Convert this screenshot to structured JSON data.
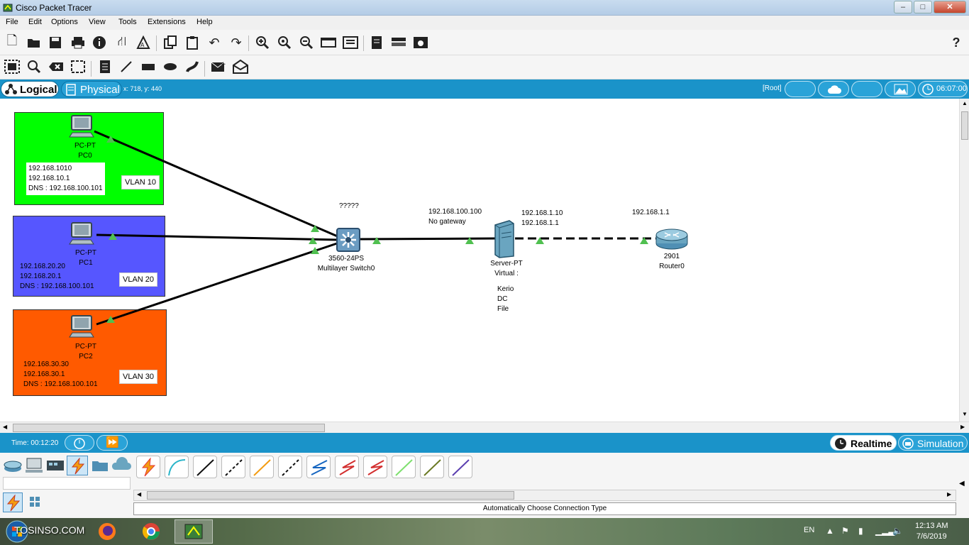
{
  "window": {
    "title": "Cisco Packet Tracer",
    "controls": [
      "–",
      "□",
      "✕"
    ]
  },
  "menu": [
    "File",
    "Edit",
    "Options",
    "View",
    "Tools",
    "Extensions",
    "Help"
  ],
  "help_glyph": "?",
  "workspace_bar": {
    "logical_label": "Logical",
    "physical_label": "Physical",
    "coords": "x: 718, y: 440",
    "root_label": "[Root]",
    "clock": "06:07:00"
  },
  "vlans": [
    {
      "label": "VLAN 10",
      "color": "#00ff00",
      "device_type": "PC-PT",
      "device_name": "PC0",
      "lines": [
        "192.168.1010",
        "192.168.10.1",
        "DNS : 192.168.100.101"
      ]
    },
    {
      "label": "VLAN 20",
      "color": "#5656ff",
      "device_type": "PC-PT",
      "device_name": "PC1",
      "lines": [
        "192.168.20.20",
        "192.168.20.1",
        "DNS : 192.168.100.101"
      ]
    },
    {
      "label": "VLAN 30",
      "color": "#ff5a00",
      "device_type": "PC-PT",
      "device_name": "PC2",
      "lines": [
        "192.168.30.30",
        "192.168.30.1",
        "DNS : 192.168.100.101"
      ]
    }
  ],
  "switch": {
    "note": "?????",
    "model": "3560-24PS",
    "name": "Multilayer Switch0"
  },
  "server": {
    "note_left": [
      "192.168.100.100",
      "No gateway"
    ],
    "note_right": [
      "192.168.1.10",
      "192.168.1.1"
    ],
    "type": "Server-PT",
    "name": "Virtual :",
    "services": [
      "Kerio",
      "DC",
      "File"
    ]
  },
  "router": {
    "note": "192.168.1.1",
    "model": "2901",
    "name": "Router0"
  },
  "bottom": {
    "time": "Time: 00:12:20",
    "realtime": "Realtime",
    "simulation": "Simulation",
    "connection_desc": "Automatically Choose Connection Type"
  },
  "connection_colors": [
    "#e53935",
    "#2bb5c9",
    "#111111",
    "#111111",
    "#f39c12",
    "#111111",
    "#1565c0",
    "#d32f2f",
    "#d32f2f",
    "#7ee06e",
    "#6b7a25",
    "#5b3fb0"
  ],
  "taskbar": {
    "watermark": "TOSINSO.COM",
    "lang": "EN",
    "time": "12:13 AM",
    "date": "7/6/2019"
  }
}
